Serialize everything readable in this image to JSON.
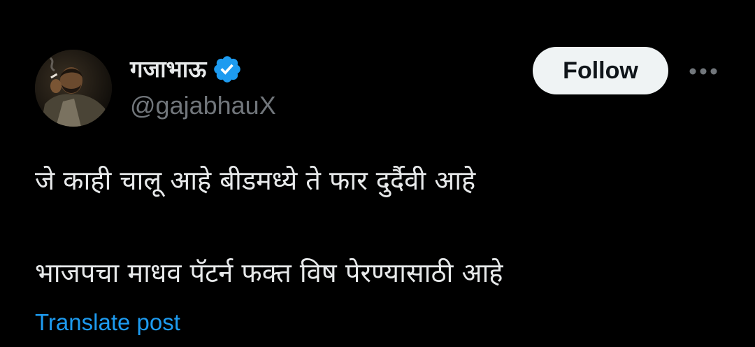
{
  "author": {
    "display_name": "गजाभाऊ",
    "handle": "@gajabhauX",
    "verified": true,
    "avatar_icon": "user-avatar-photo"
  },
  "actions": {
    "follow_label": "Follow",
    "more_icon": "more-options-icon"
  },
  "tweet": {
    "line1": "जे काही चालू आहे बीडमध्ये ते फार दुर्दैवी आहे",
    "line2": "भाजपचा माधव पॅटर्न फक्त विष पेरण्यासाठी आहे"
  },
  "footer": {
    "translate_label": "Translate post"
  },
  "colors": {
    "background": "#000000",
    "text_primary": "#e7e9ea",
    "text_secondary": "#71767b",
    "link": "#1d9bf0",
    "follow_bg": "#eff3f4",
    "verified": "#1d9bf0"
  }
}
